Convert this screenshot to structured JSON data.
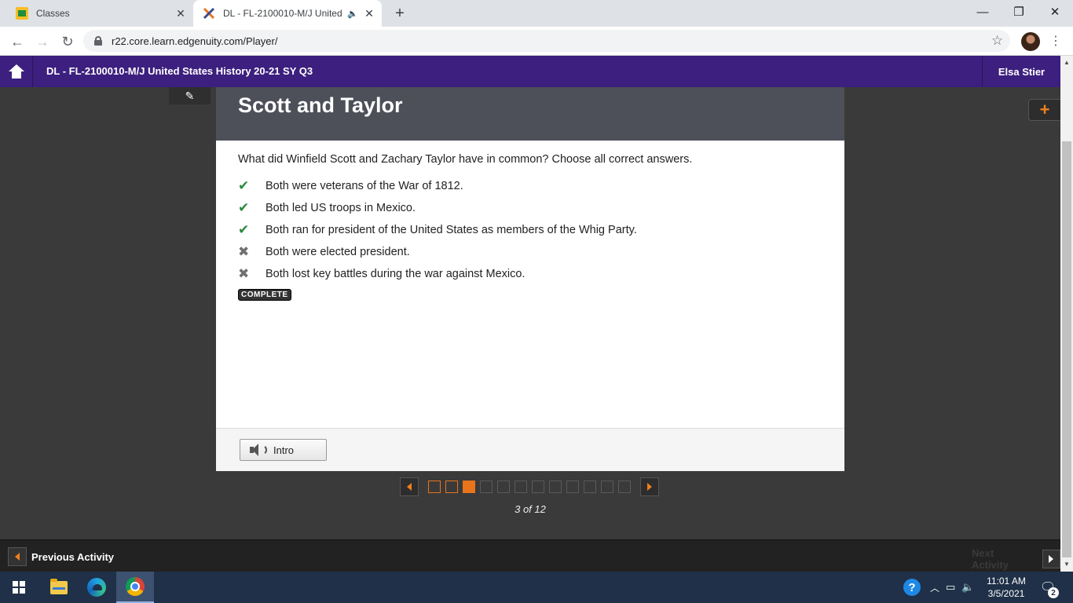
{
  "browser": {
    "tabs": [
      {
        "title": "Classes",
        "favicon": "google-classroom-icon",
        "close": "✕"
      },
      {
        "title": "DL - FL-2100010-M/J United",
        "favicon": "edgenuity-icon",
        "audio": "🔈",
        "close": "✕"
      }
    ],
    "new_tab": "+",
    "window_controls": {
      "minimize": "—",
      "maximize": "❐",
      "close": "✕"
    },
    "url": "r22.core.learn.edgenuity.com/Player/",
    "back": "←",
    "forward": "→",
    "reload": "↻",
    "bookmark": "☆",
    "menu": "⋮"
  },
  "header": {
    "course_title": "DL - FL-2100010-M/J United States History 20-21 SY Q3",
    "user_name": "Elsa Stier",
    "brand_color": "#3c1f7e"
  },
  "tools": {
    "pencil": "✎",
    "plus": "+"
  },
  "question": {
    "title": "Scott and Taylor",
    "prompt": "What did Winfield Scott and Zachary Taylor have in common? Choose all correct answers.",
    "answers": [
      {
        "text": "Both were veterans of the War of 1812.",
        "status": "correct",
        "mark": "✔"
      },
      {
        "text": "Both led US troops in Mexico.",
        "status": "correct",
        "mark": "✔"
      },
      {
        "text": "Both ran for president of the United States as members of the Whig Party.",
        "status": "correct",
        "mark": "✔"
      },
      {
        "text": "Both were elected president.",
        "status": "incorrect",
        "mark": "✖"
      },
      {
        "text": "Both lost key battles during the war against Mexico.",
        "status": "incorrect",
        "mark": "✖"
      }
    ],
    "badge": "COMPLETE",
    "intro_button": "Intro"
  },
  "pager": {
    "current": 3,
    "total": 12,
    "label": "3 of 12",
    "accent_color": "#e8741c"
  },
  "activity_nav": {
    "previous": "Previous Activity",
    "next": "Next Activity"
  },
  "taskbar": {
    "time": "11:01 AM",
    "date": "3/5/2021",
    "notifications": "2",
    "help": "?"
  }
}
